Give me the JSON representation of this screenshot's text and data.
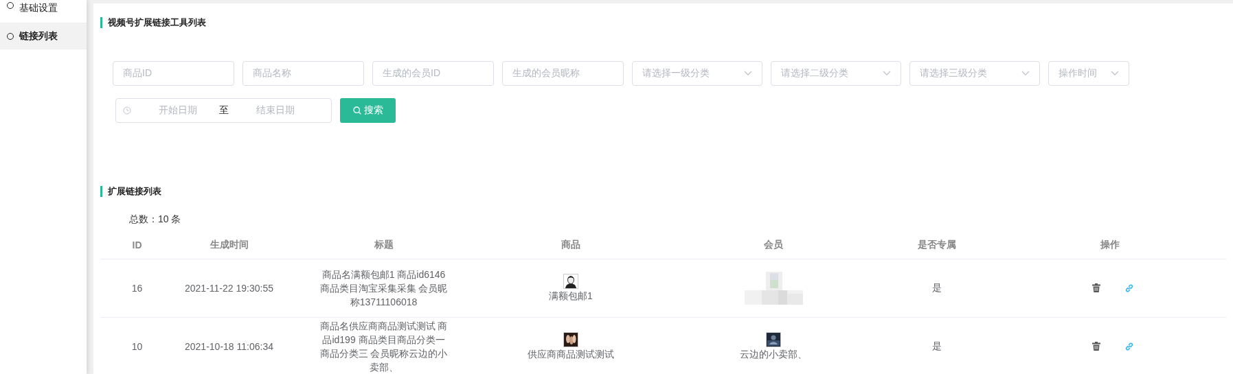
{
  "sidebar": {
    "items": [
      {
        "label": "基础设置",
        "selected": false
      },
      {
        "label": "链接列表",
        "selected": true
      }
    ]
  },
  "search_section": {
    "title": "视频号扩展链接工具列表",
    "filters": [
      {
        "kind": "input",
        "placeholder": "商品ID"
      },
      {
        "kind": "input",
        "placeholder": "商品名称"
      },
      {
        "kind": "input",
        "placeholder": "生成的会员ID"
      },
      {
        "kind": "input",
        "placeholder": "生成的会员昵称"
      },
      {
        "kind": "select",
        "placeholder": "请选择一级分类"
      },
      {
        "kind": "select",
        "placeholder": "请选择二级分类"
      },
      {
        "kind": "select",
        "placeholder": "请选择三级分类"
      },
      {
        "kind": "select",
        "placeholder": "操作时间"
      }
    ],
    "date_range": {
      "start_placeholder": "开始日期",
      "separator": "至",
      "end_placeholder": "结束日期"
    },
    "search_button": "搜索"
  },
  "list_section": {
    "title": "扩展链接列表",
    "total": "总数：10 条",
    "table": {
      "columns": [
        "ID",
        "生成时间",
        "标题",
        "商品",
        "会员",
        "是否专属",
        "操作"
      ],
      "rows": [
        {
          "id": "16",
          "created": "2021-11-22 19:30:55",
          "title": "商品名满额包邮1 商品id6146 商品类目淘宝采集采集 会员昵称13711106018",
          "product": {
            "name": "满额包邮1"
          },
          "member": {
            "kind": "blurred"
          },
          "exclusive": "是"
        },
        {
          "id": "10",
          "created": "2021-10-18 11:06:34",
          "title": "商品名供应商商品测试测试 商品id199 商品类目商品分类一商品分类三 会员昵称云边的小卖部、",
          "product": {
            "name": "供应商商品测试测试"
          },
          "member": {
            "kind": "thumbnail",
            "name": "云边的小卖部、"
          },
          "exclusive": "是"
        }
      ]
    }
  }
}
